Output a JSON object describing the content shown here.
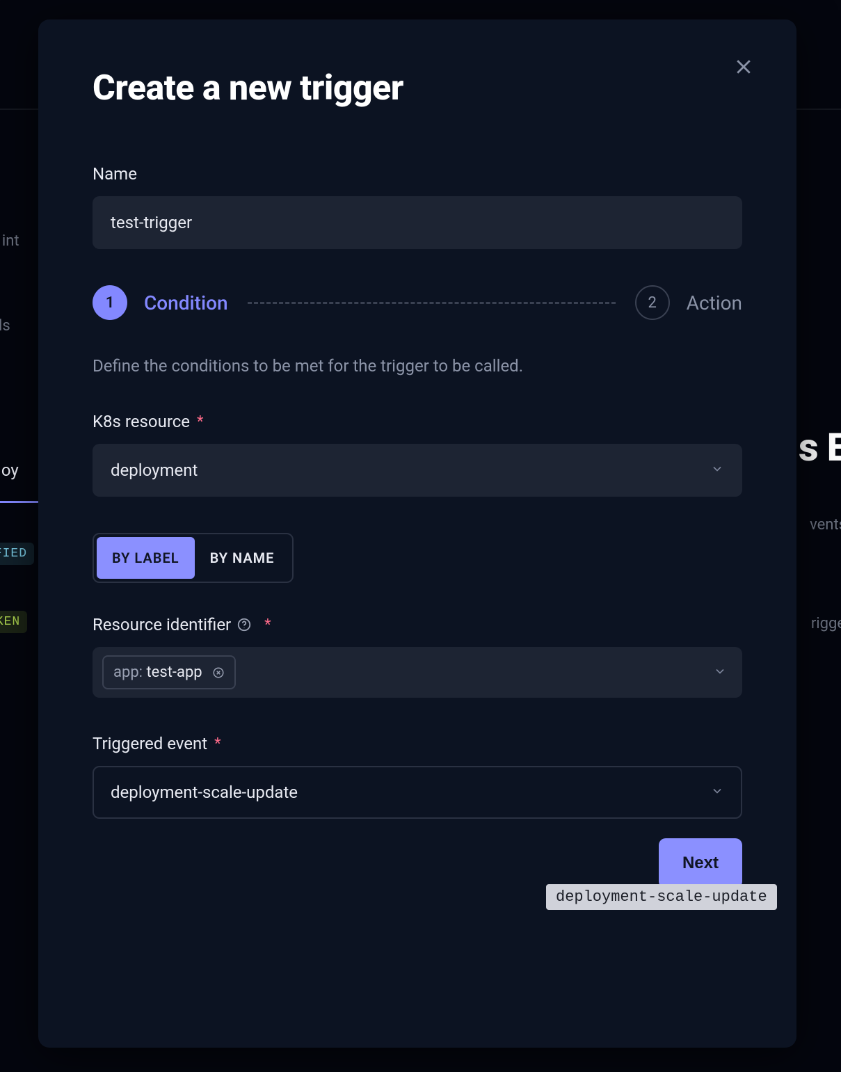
{
  "background": {
    "text_int_fragment": "r int",
    "text_ls_fragment": "ls",
    "tab_loy_fragment": "loy",
    "badge_modified_fragment": "IFIED",
    "badge_cken_fragment": "CKEN",
    "heading_sE_fragment": "s E",
    "text_vents_fragment": "vents",
    "text_rigge_fragment": "rigge"
  },
  "modal": {
    "title": "Create a new trigger",
    "close_label": "Close",
    "name": {
      "label": "Name",
      "value": "test-trigger"
    },
    "stepper": {
      "step1_num": "1",
      "step1_label": "Condition",
      "step2_num": "2",
      "step2_label": "Action"
    },
    "description": "Define the conditions to be met for the trigger to be called.",
    "k8s_resource": {
      "label": "K8s resource",
      "value": "deployment"
    },
    "segmented": {
      "by_label": "BY LABEL",
      "by_name": "BY NAME"
    },
    "resource_identifier": {
      "label": "Resource identifier",
      "tag_key": "app:",
      "tag_value": "test-app"
    },
    "triggered_event": {
      "label": "Triggered event",
      "value": "deployment-scale-update",
      "tooltip": "deployment-scale-update"
    },
    "next_label": "Next"
  }
}
